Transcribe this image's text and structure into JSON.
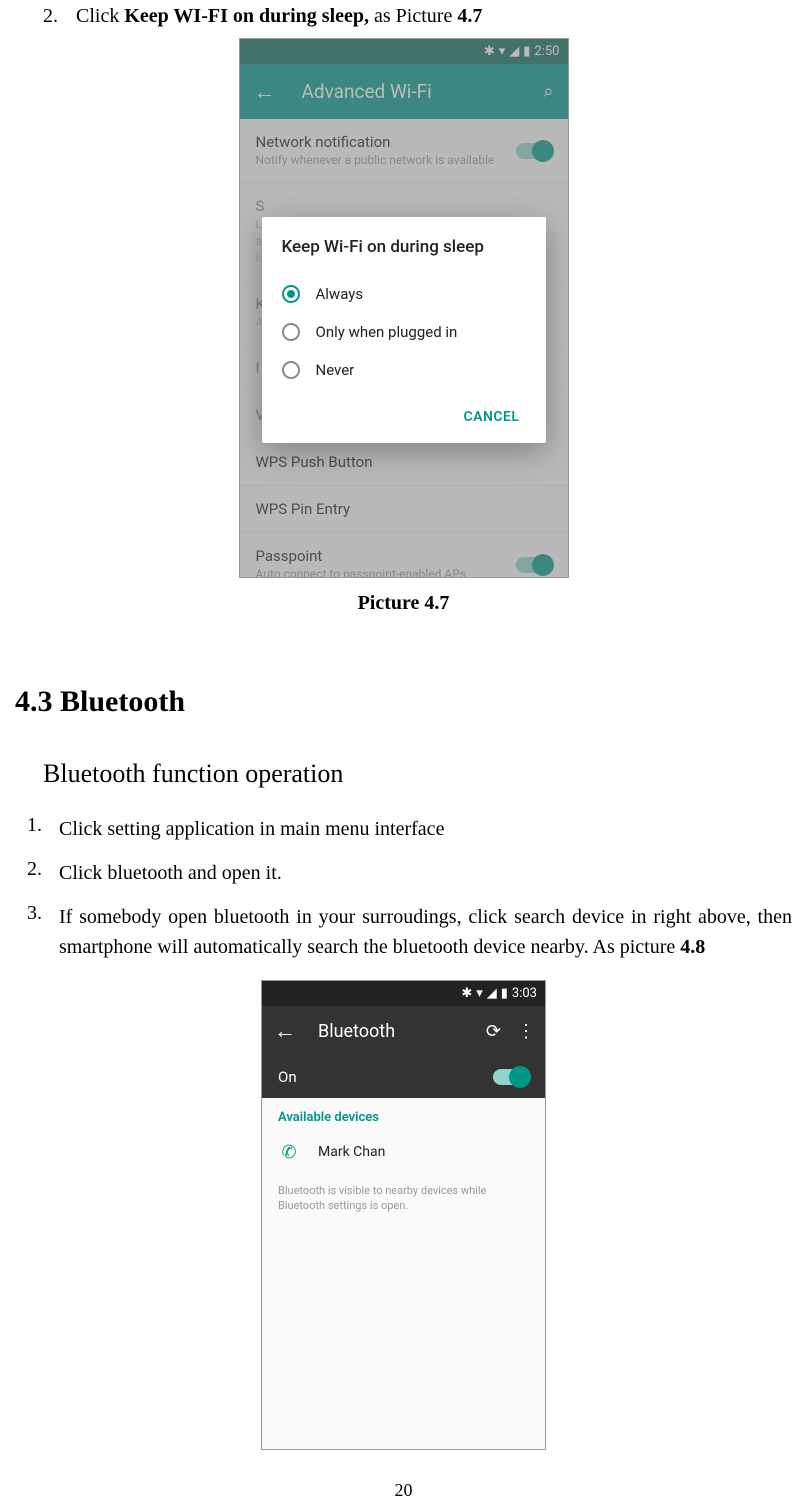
{
  "step2": {
    "num": "2.",
    "pre": "Click ",
    "bold": "Keep WI-FI on during sleep,",
    "post": " as Picture ",
    "ref": "4.7"
  },
  "phone1": {
    "time": "2:50",
    "title": "Advanced Wi-Fi",
    "rows": {
      "netnotif": {
        "title": "Network notification",
        "sub": "Notify whenever a public network is available"
      },
      "scan": {
        "title": "S",
        "sub1": "L",
        "sub2": "a",
        "sub3": "is"
      },
      "k": {
        "title": "K",
        "sub": "A"
      },
      "i": {
        "title": "I"
      },
      "v": {
        "title": "V"
      },
      "wps_push": {
        "title": "WPS Push Button"
      },
      "wps_pin": {
        "title": "WPS Pin Entry"
      },
      "passpoint": {
        "title": "Passpoint",
        "sub": "Auto connect to passpoint-enabled APs"
      }
    },
    "dialog": {
      "title": "Keep Wi-Fi on during sleep",
      "opt1": "Always",
      "opt2": "Only when plugged in",
      "opt3": "Never",
      "cancel": "CANCEL"
    }
  },
  "caption1": "Picture 4.7",
  "heading": "4.3   Bluetooth",
  "subheading": "Bluetooth function operation",
  "steps": {
    "s1": {
      "num": "1.",
      "text": "Click setting application in main menu interface"
    },
    "s2": {
      "num": "2.",
      "text": "Click bluetooth and open it."
    },
    "s3": {
      "num": "3.",
      "text": "If somebody open bluetooth in your surroudings, click search device in right above, then smartphone will automatically search the bluetooth device nearby. As picture ",
      "ref": "4.8"
    }
  },
  "phone2": {
    "time": "3:03",
    "title": "Bluetooth",
    "on": "On",
    "avail": "Available devices",
    "device": "Mark Chan",
    "note": "Bluetooth is visible to nearby devices while Bluetooth settings is open."
  },
  "pagenum": "20"
}
